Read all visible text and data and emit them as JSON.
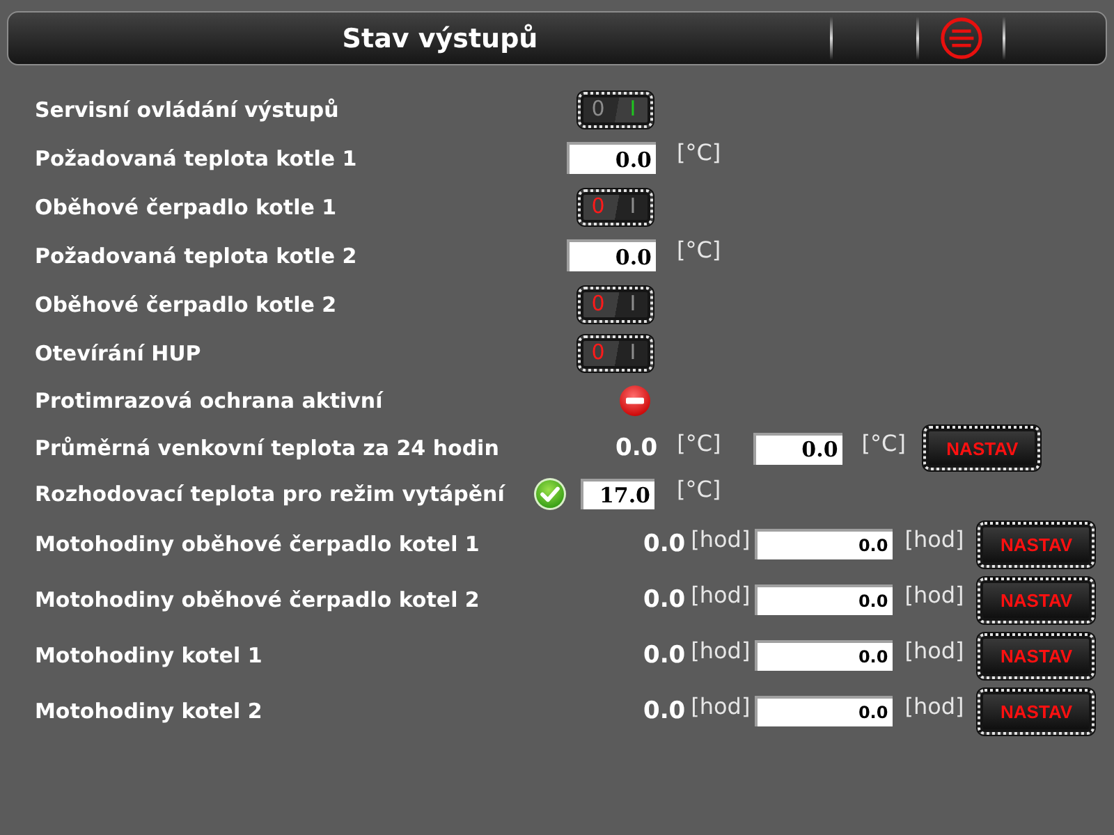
{
  "header": {
    "title": "Stav výstupů"
  },
  "rows": [
    {
      "kind": "toggle",
      "label": "Servisní ovládání výstupů",
      "off_label": "0",
      "on_label": "I",
      "on": true
    },
    {
      "kind": "setpoint",
      "label": "Požadovaná teplota kotle 1",
      "value": "0.0",
      "unit": "[°C]"
    },
    {
      "kind": "toggle",
      "label": "Oběhové čerpadlo kotle 1",
      "off_label": "0",
      "on_label": "I",
      "on": false
    },
    {
      "kind": "setpoint",
      "label": "Požadovaná teplota kotle 2",
      "value": "0.0",
      "unit": "[°C]"
    },
    {
      "kind": "toggle",
      "label": "Oběhové čerpadlo kotle 2",
      "off_label": "0",
      "on_label": "I",
      "on": false
    },
    {
      "kind": "toggle",
      "label": "Otevírání HUP",
      "off_label": "0",
      "on_label": "I",
      "on": false
    },
    {
      "kind": "status",
      "label": "Protimrazová ochrana aktivní",
      "active": false
    },
    {
      "kind": "adjust",
      "label": "Průměrná venkovní teplota za 24 hodin",
      "reading": "0.0",
      "reading_unit": "[°C]",
      "value": "0.0",
      "unit": "[°C]",
      "button": "NASTAV"
    },
    {
      "kind": "decision",
      "label": "Rozhodovací teplota pro režim vytápění",
      "active": true,
      "value": "17.0",
      "unit": "[°C]"
    },
    {
      "kind": "hours",
      "label": "Motohodiny oběhové čerpadlo kotel 1",
      "reading": "0.0",
      "reading_unit": "[hod]",
      "value": "0.0",
      "unit": "[hod]",
      "button": "NASTAV"
    },
    {
      "kind": "hours",
      "label": "Motohodiny oběhové čerpadlo kotel 2",
      "reading": "0.0",
      "reading_unit": "[hod]",
      "value": "0.0",
      "unit": "[hod]",
      "button": "NASTAV"
    },
    {
      "kind": "hours",
      "label": "Motohodiny kotel 1",
      "reading": "0.0",
      "reading_unit": "[hod]",
      "value": "0.0",
      "unit": "[hod]",
      "button": "NASTAV"
    },
    {
      "kind": "hours",
      "label": "Motohodiny kotel 2",
      "reading": "0.0",
      "reading_unit": "[hod]",
      "value": "0.0",
      "unit": "[hod]",
      "button": "NASTAV"
    }
  ]
}
